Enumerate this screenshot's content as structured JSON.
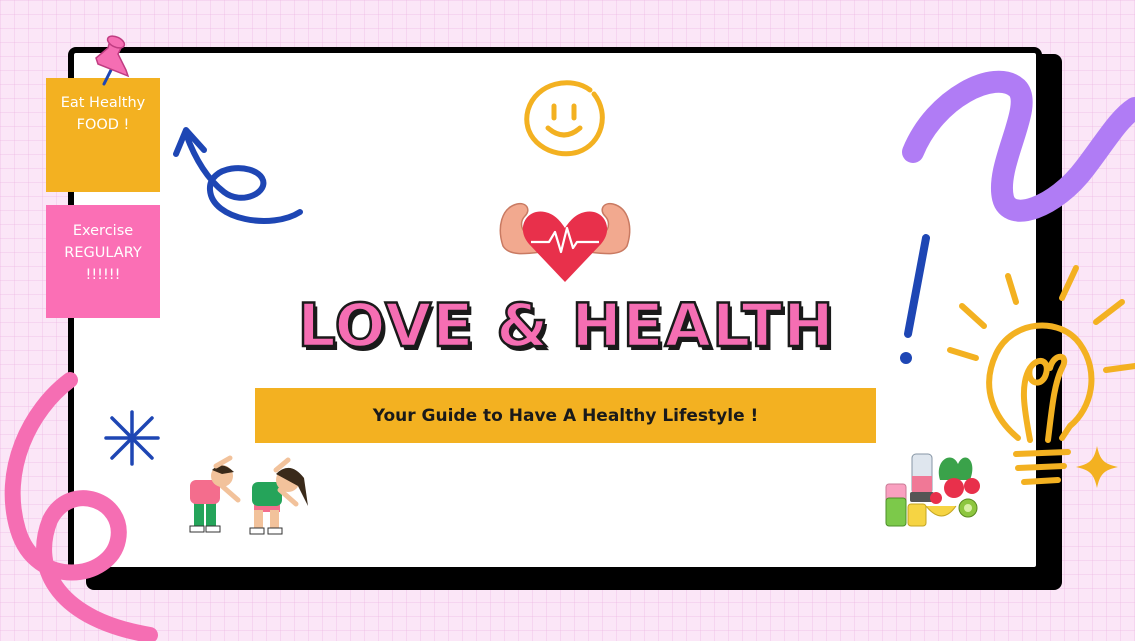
{
  "notes": {
    "food": [
      "Eat Healthy",
      "FOOD !"
    ],
    "exercise": [
      "Exercise",
      "REGULARY",
      "!!!!!!"
    ]
  },
  "title": "LOVE & HEALTH",
  "subtitle": "Your Guide to Have A Healthy Lifestyle !",
  "colors": {
    "background": "#fbe6f7",
    "pink": "#f56eb3",
    "yellow": "#f3b121",
    "blue": "#1e46b4",
    "purple": "#b07cf5",
    "heart": "#e8304b"
  },
  "icons": [
    "pushpin-icon",
    "smiley-icon",
    "heart-arms-icon",
    "lightbulb-icon",
    "sparkle-icon",
    "asterisk-icon",
    "curly-arrow-icon",
    "exercising-kids-icon",
    "food-icon"
  ]
}
